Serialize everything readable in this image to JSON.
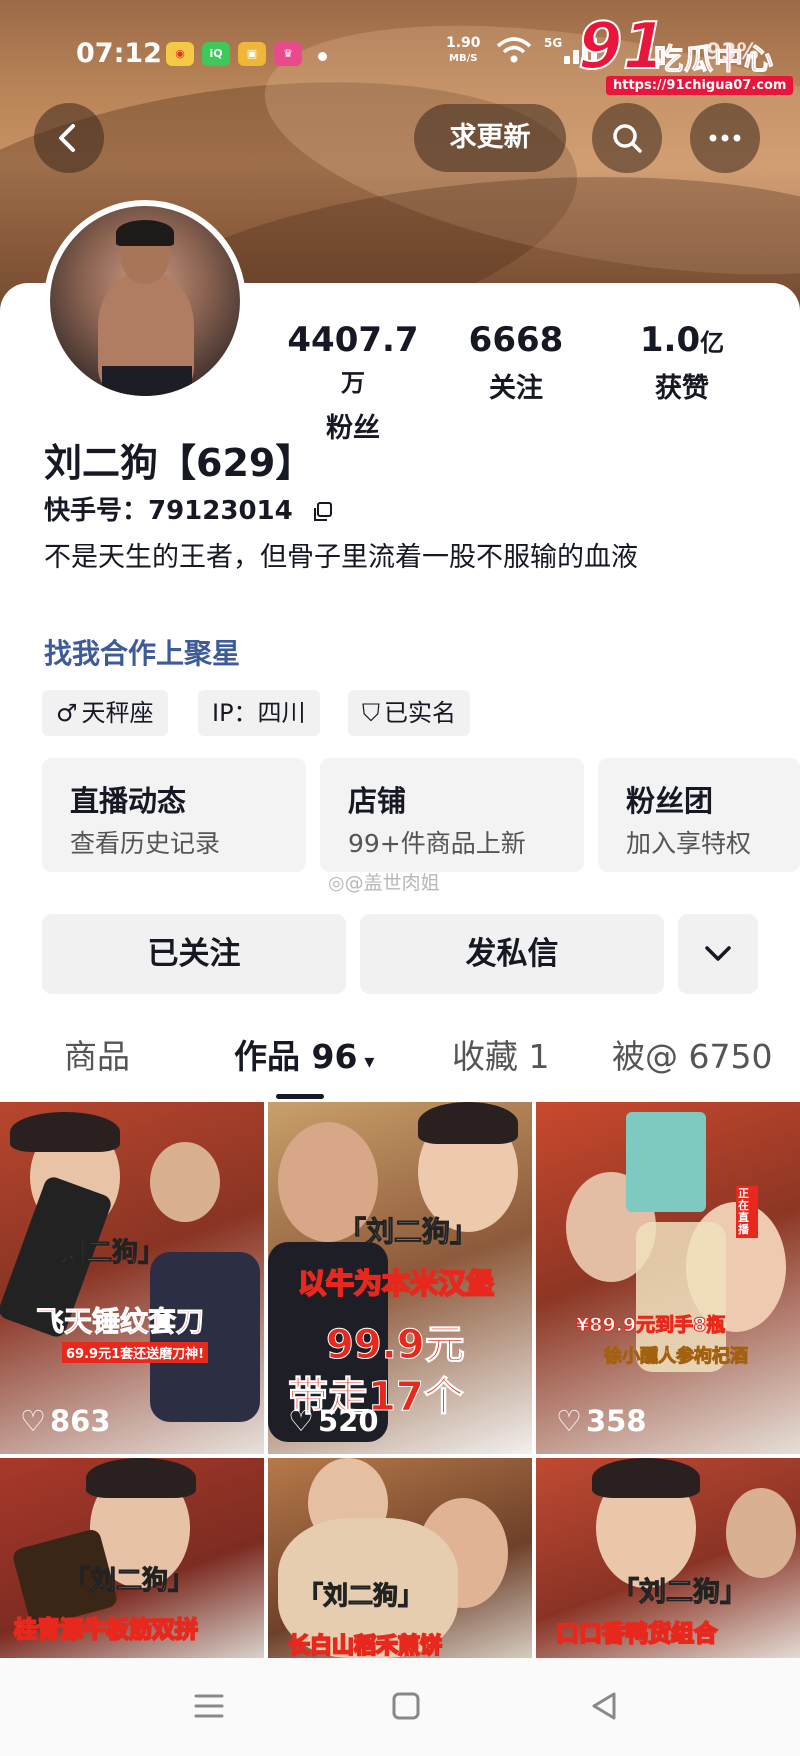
{
  "status_bar": {
    "time": "07:12",
    "net_speed_top": "1.90",
    "net_speed_unit": "MB/S",
    "network": "5G",
    "battery": "93%",
    "app_icons": [
      "weibo-icon",
      "iqiyi-icon",
      "app-icon",
      "app-icon"
    ]
  },
  "watermark": {
    "number": "91",
    "name": "吃瓜中心",
    "url": "https://91chigua07.com"
  },
  "header": {
    "update_label": "求更新"
  },
  "profile": {
    "name": "刘二狗【629】",
    "uid": "快手号：79123014",
    "bio": "不是天生的王者，但骨子里流着一股不服输的血液",
    "link": "找我合作上聚星",
    "stats": [
      {
        "num": "4407.7",
        "unit": "万",
        "label": "粉丝"
      },
      {
        "num": "6668",
        "unit": "",
        "label": "关注"
      },
      {
        "num": "1.0",
        "unit": "亿",
        "label": "获赞"
      }
    ],
    "tags": [
      {
        "icon": "♂",
        "text": "天秤座"
      },
      {
        "icon": "",
        "text": "IP：四川"
      },
      {
        "icon": "⛉",
        "text": "已实名"
      }
    ]
  },
  "features": [
    {
      "title": "直播动态",
      "subtitle": "查看历史记录"
    },
    {
      "title": "店铺",
      "subtitle": "99+件商品上新"
    },
    {
      "title": "粉丝团",
      "subtitle": "加入享特权"
    }
  ],
  "weibo_watermark": "@盖世肉姐",
  "actions": {
    "follow_label": "已关注",
    "message_label": "发私信"
  },
  "tabs": [
    {
      "label": "商品"
    },
    {
      "label": "作品 96"
    },
    {
      "label": "收藏 1"
    },
    {
      "label": "被@ 6750"
    }
  ],
  "videos": [
    {
      "caption": "「刘二狗」",
      "caption2": "飞天锤纹套刀",
      "caption3": "69.9元1套还送磨刀神!",
      "likes": "863"
    },
    {
      "caption": "「刘二狗」",
      "caption2": "以牛为本米汉堡",
      "caption3": "99.9元",
      "caption4": "带走17个",
      "likes": "520"
    },
    {
      "caption": "¥89.9元到手8瓶",
      "caption2": "徐小醺人参枸杞酒",
      "caption3": "正在直播",
      "likes": "358"
    },
    {
      "caption": "「刘二狗」",
      "caption2": "桂青源牛板筋双拼",
      "likes": ""
    },
    {
      "caption": "「刘二狗」",
      "caption2": "长白山稻禾煎饼",
      "likes": ""
    },
    {
      "caption": "「刘二狗」",
      "caption2": "口口香鸭货组合",
      "likes": ""
    }
  ],
  "colors": {
    "accent_link": "#3d5a99",
    "card_bg": "#f3f3f4",
    "watermark_red": "#e8163a"
  }
}
